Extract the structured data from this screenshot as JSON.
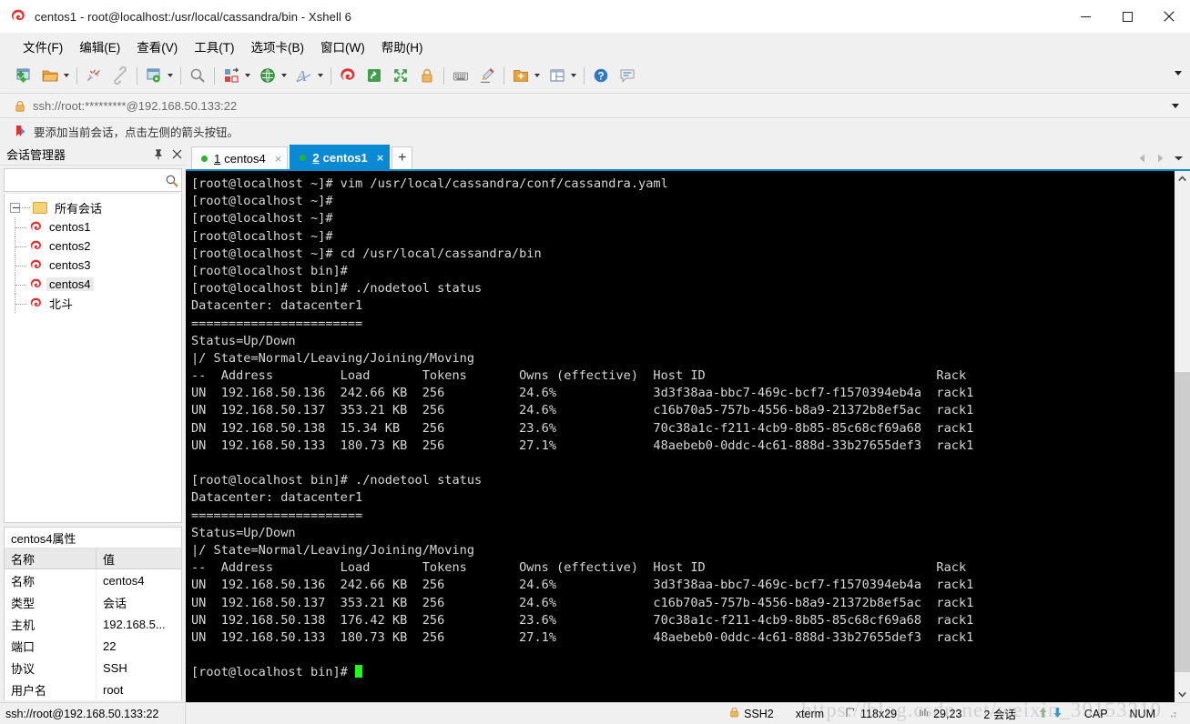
{
  "window": {
    "title": "centos1 - root@localhost:/usr/local/cassandra/bin - Xshell 6",
    "minimize_label": "Minimize",
    "maximize_label": "Maximize",
    "close_label": "Close"
  },
  "menubar": {
    "items": [
      {
        "label": "文件(F)",
        "name": "menu-file"
      },
      {
        "label": "编辑(E)",
        "name": "menu-edit"
      },
      {
        "label": "查看(V)",
        "name": "menu-view"
      },
      {
        "label": "工具(T)",
        "name": "menu-tools"
      },
      {
        "label": "选项卡(B)",
        "name": "menu-tabs"
      },
      {
        "label": "窗口(W)",
        "name": "menu-window"
      },
      {
        "label": "帮助(H)",
        "name": "menu-help"
      }
    ]
  },
  "toolbar": {
    "icons": [
      "new-session-icon",
      "open-folder-icon",
      "disconnect-icon",
      "reconnect-icon",
      "session-properties-icon",
      "find-icon",
      "file-transfer-icon",
      "globe-icon",
      "font-icon",
      "xshell-icon",
      "xftp-icon",
      "fullscreen-icon",
      "lock-icon",
      "keyboard-icon",
      "highlight-icon",
      "folder-add-icon",
      "split-view-icon",
      "help-icon",
      "comment-icon"
    ],
    "overflow_label": "More toolbar buttons"
  },
  "quick_connect": {
    "value": "ssh://root:*********@192.168.50.133:22",
    "lock_icon": "lock-icon",
    "dropdown_label": "History"
  },
  "tip": {
    "icon": "bookmark-arrow-icon",
    "text": "要添加当前会话，点击左侧的箭头按钮。"
  },
  "session_manager": {
    "title": "会话管理器",
    "pin_label": "固定",
    "close_label": "关闭",
    "search_placeholder": "",
    "search_value": "",
    "search_icon": "search-icon",
    "root": {
      "label": "所有会话",
      "icon": "folder-icon"
    },
    "sessions": [
      {
        "label": "centos1",
        "icon": "xshell-session-icon",
        "selected": false
      },
      {
        "label": "centos2",
        "icon": "xshell-session-icon",
        "selected": false
      },
      {
        "label": "centos3",
        "icon": "xshell-session-icon",
        "selected": false
      },
      {
        "label": "centos4",
        "icon": "xshell-session-icon",
        "selected": true
      },
      {
        "label": "北斗",
        "icon": "xshell-session-icon",
        "selected": false
      }
    ]
  },
  "properties": {
    "title": "centos4属性",
    "header": {
      "name": "名称",
      "value": "值"
    },
    "rows": [
      {
        "name": "名称",
        "value": "centos4"
      },
      {
        "name": "类型",
        "value": "会话"
      },
      {
        "name": "主机",
        "value": "192.168.5..."
      },
      {
        "name": "端口",
        "value": "22"
      },
      {
        "name": "协议",
        "value": "SSH"
      },
      {
        "name": "用户名",
        "value": "root"
      }
    ]
  },
  "tabs": {
    "items": [
      {
        "num": "1",
        "label": "centos4",
        "active": false,
        "close_label": "×",
        "status_icon": "connected-dot-icon"
      },
      {
        "num": "2",
        "label": "centos1",
        "active": true,
        "close_label": "×",
        "status_icon": "connected-dot-icon"
      }
    ],
    "new_tab_label": "+",
    "prev_label": "◀",
    "next_label": "▶",
    "list_label": "▾"
  },
  "terminal": {
    "cursor_visible": true,
    "lines": [
      "[root@localhost ~]# vim /usr/local/cassandra/conf/cassandra.yaml",
      "[root@localhost ~]#",
      "[root@localhost ~]#",
      "[root@localhost ~]#",
      "[root@localhost ~]# cd /usr/local/cassandra/bin",
      "[root@localhost bin]#",
      "[root@localhost bin]# ./nodetool status",
      "Datacenter: datacenter1",
      "=======================",
      "Status=Up/Down",
      "|/ State=Normal/Leaving/Joining/Moving",
      "--  Address         Load       Tokens       Owns (effective)  Host ID                               Rack",
      "UN  192.168.50.136  242.66 KB  256          24.6%             3d3f38aa-bbc7-469c-bcf7-f1570394eb4a  rack1",
      "UN  192.168.50.137  353.21 KB  256          24.6%             c16b70a5-757b-4556-b8a9-21372b8ef5ac  rack1",
      "DN  192.168.50.138  15.34 KB   256          23.6%             70c38a1c-f211-4cb9-8b85-85c68cf69a68  rack1",
      "UN  192.168.50.133  180.73 KB  256          27.1%             48aebeb0-0ddc-4c61-888d-33b27655def3  rack1",
      "",
      "[root@localhost bin]# ./nodetool status",
      "Datacenter: datacenter1",
      "=======================",
      "Status=Up/Down",
      "|/ State=Normal/Leaving/Joining/Moving",
      "--  Address         Load       Tokens       Owns (effective)  Host ID                               Rack",
      "UN  192.168.50.136  242.66 KB  256          24.6%             3d3f38aa-bbc7-469c-bcf7-f1570394eb4a  rack1",
      "UN  192.168.50.137  353.21 KB  256          24.6%             c16b70a5-757b-4556-b8a9-21372b8ef5ac  rack1",
      "UN  192.168.50.138  176.42 KB  256          23.6%             70c38a1c-f211-4cb9-8b85-85c68cf69a68  rack1",
      "UN  192.168.50.133  180.73 KB  256          27.1%             48aebeb0-0ddc-4c61-888d-33b27655def3  rack1",
      "",
      "[root@localhost bin]# "
    ]
  },
  "statusbar": {
    "connection": "ssh://root@192.168.50.133:22",
    "protocol": "SSH2",
    "terminal_type": "xterm",
    "size": "118x29",
    "cursor_pos": "29,23",
    "sessions": "2 会话",
    "cap": "CAP",
    "num": "NUM",
    "lock_icon": "lock-icon",
    "size_icon": "resize-icon",
    "pos_icon": "cursor-pos-icon",
    "up_icon": "upload-arrow-icon",
    "down_icon": "download-arrow-icon"
  },
  "watermark": {
    "text": "https://blog.csdn.net/weixin_39153210"
  },
  "colors": {
    "accent": "#0a8ad2",
    "terminal_bg": "#000000",
    "terminal_fg": "#d8d8d8",
    "cursor": "#1aff1a",
    "chrome": "#f0f0f0"
  }
}
